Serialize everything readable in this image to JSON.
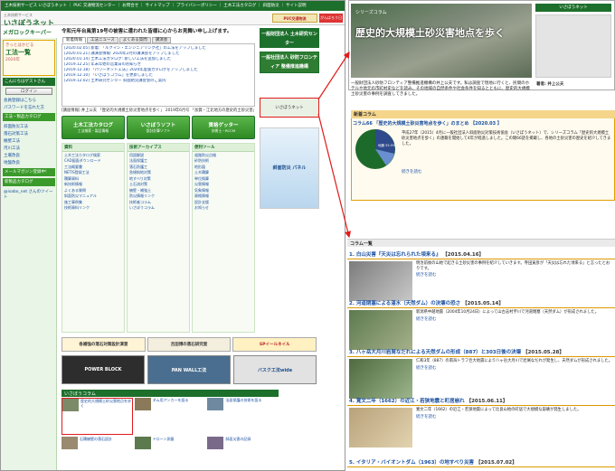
{
  "left": {
    "topbar": "土木技術サービス いさぼうネット ｜ PUC 交通物流センター ｜ お問合せ ｜ サイトマップ ｜ プライバシーポリシー ｜ 土木工法カタログ ｜ 斜面防災 ｜ サイト説明",
    "logo": "いさぼうネット",
    "logo_sub": "土木技術サービス",
    "hdr_banner": "PUC交通物流",
    "hdr_badge": "がんばろう日本",
    "sidebar": {
      "title": "メガロックキーパー",
      "promo_line1": "きっとはかどる",
      "promo_big": "工法一覧",
      "promo_year": "2020年",
      "head_login": "こんにちはゲストさん",
      "login_btn": "ログイン",
      "links": [
        "会員登録はこちら",
        "パスワードを忘れた方"
      ],
      "green1": "工法・製品カタログ",
      "items": [
        "斜面防災工法",
        "落石対策工法",
        "擁壁工法",
        "河川工法",
        "土壌改良",
        "地盤改良"
      ],
      "green2": "メールマガジン登録中!",
      "green3": "新製品カタログ",
      "twitter": "@isabo_net さんのツイート"
    },
    "slogan": "令和元年台風第19号の被害に遭われた皆様に心からお見舞い申し上げます。",
    "tabs": [
      "新着情報",
      "工法ニュース",
      "よくある質問",
      "講演会"
    ],
    "news": [
      "[2020.02.05] 新着: 「ルクマン・エンジニアリング社」の工法をアップしました",
      "[2020.01.21] 講演会情報: 2020年2月の講演会をアップしました",
      "[2020.01.14] 土木工法カタログ: 新しい工法を追加しました",
      "[2019.12.25] 年末年始の営業日のお知らせ",
      "[2019.12.18] 「パワーネット工法」2020年度版カタログをアップしました",
      "[2019.12.10] 「いさぼうコラム」を更新しました",
      "[2019.12.02] 土木研究センター 斜面防災講習会のご案内"
    ],
    "infobar": "[講座情報] 井上公夫 「歴史的大規模土砂災害地点を歩く」 2019年6月号 「加賀・江北地方の歴史的土砂災害」",
    "navbtns": [
      {
        "label": "土木工法カタログ",
        "sub": "工法検索・製品情報"
      },
      {
        "label": "いさぼうソフト",
        "sub": "設計計算ソフト"
      },
      {
        "label": "資格ゲッター",
        "sub": "技術士・RCCM"
      }
    ],
    "columns": [
      {
        "head": "資料",
        "items": [
          "土木工法カタログ検索",
          "CAD図面ダウンロード",
          "工法概要書",
          "NETIS登録工法",
          "積算資料",
          "新技術情報",
          "よくある質問",
          "斜面防災マニュアル",
          "施工事例集",
          "技術資料リンク"
        ]
      },
      {
        "head": "技術アーカイブス",
        "items": [
          "用語解説",
          "法面保護工",
          "落石防護工",
          "急傾斜地対策",
          "地すべり対策",
          "土石流対策",
          "擁壁・補強土",
          "防災情報リンク",
          "技術者コラム",
          "いさぼうコラム"
        ]
      },
      {
        "head": "便利ツール",
        "items": [
          "道路防災点検",
          "砂防技術",
          "地形図",
          "土木積算",
          "単位換算",
          "災害情報",
          "気象情報",
          "資格情報",
          "設計支援",
          "お知らせ"
        ]
      }
    ],
    "right_banners": [
      "一般財団法人 土木研究センター",
      "一般社団法人 砂防フロンティア 整備推進機構",
      "いさぼうネット",
      "斜面防災 パネル"
    ],
    "promos": [
      {
        "label": "各補強の落石対策設計演習"
      },
      {
        "label": "吉田博の落石研究室"
      },
      {
        "label": "SPイールネイル"
      }
    ],
    "cards": [
      "POWER BLOCK",
      "PAN WALL工法",
      "バスク工法wide"
    ],
    "column_head": "いさぼうコラム",
    "column_items": [
      "歴史的大規模土砂災害地点を歩く",
      "ダム用アンカーを語る",
      "法面保護の技術を語る",
      "石積擁壁の落石設計",
      "ドローン測量",
      "斜面災害の記録"
    ]
  },
  "right": {
    "logo": "いさぼうネット",
    "series": "シリーズコラム",
    "main_title": "歴史的大規模土砂災害地点を歩く",
    "doc_author": "著者: 井上公夫",
    "intro": "一般財団法人砂防フロンティア整備推進機構の井上公夫です。私は調査で現地に行くと、民間のホテルや地元の市町村史などを読み、その地域の自然条件や社会条件を知るとともに、歴史的大規模土砂災害の事例を調査してきました。",
    "chart_box_head": "新着コラム",
    "chart_box_title": "コラム66 「歴史的大規模土砂災害地点を歩く」のまとめ 【2020.03 】",
    "chart_box_text": "平成27年（2015）4月に一般社団法人斜面防災対策技術協会（いさぼうネット）で、シリーズコラム「歴史的大規模土砂災害地点を歩く」の連載を開始して4年が経過しました。この間66話を掲載し、各地の土砂災害の歴史を紹介してきました。",
    "chart_box_link": "続きを読む",
    "pie_label": "地震 55.5%",
    "list_head": "コラム一覧",
    "entries": [
      {
        "title": "1. 白山災害『天災は忘れられた頃来る』",
        "date": "【2015.04.16】",
        "text": "明治前後の山地で起きる土砂災害の事例を紹介していきます。寺田寅彦が「天災は忘れた頃来る」と言ったとおりです。",
        "link": "続きを読む"
      },
      {
        "title": "2. 河道閉塞による湛水（天然ダム）の決壊の恐さ",
        "date": "【2015.05.14】",
        "text": "新潟県中越地震（2004年10月24日）によって山古志村芋川で河道閉塞（天然ダム）が形成されました。",
        "link": "続きを読む"
      },
      {
        "title": "3. 八ヶ岳大月川岩屑なだれによる天然ダムの形成（887）と303日後の決壊",
        "date": "【2015.05.28】",
        "text": "仁和3年（887）の南海トラフ巨大地震により八ヶ岳大月川で岩屑なだれが発生し、天然ダムが形成されました。",
        "link": "続きを読む"
      },
      {
        "title": "4. 寛文二年（1662）の近江・若狭地震と町居崩れ",
        "date": "【2015.06.11】",
        "text": "寛文二年（1662）の近江・若狭地震によって比良山地の町居で大規模な崩壊が発生しました。",
        "link": "続きを読む"
      },
      {
        "title": "5. イタリア・バイオントダム（1963）の地すべり災害",
        "date": "【2015.07.02】",
        "text": "",
        "link": ""
      }
    ]
  }
}
